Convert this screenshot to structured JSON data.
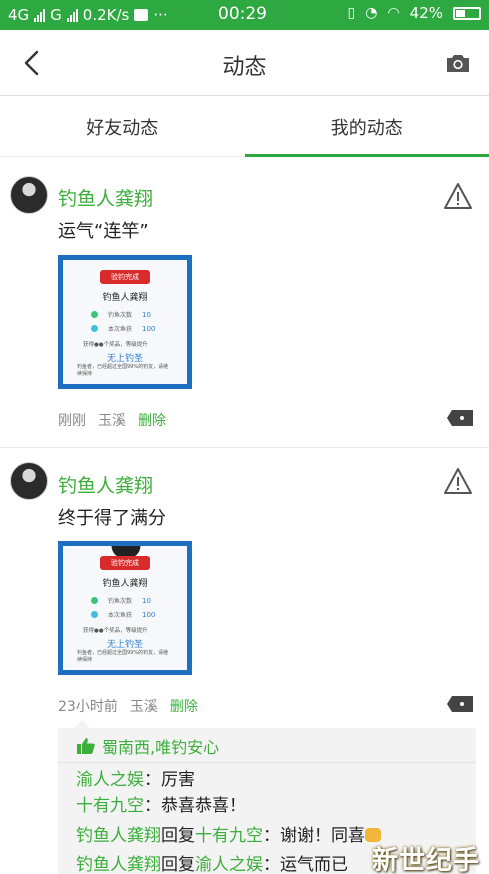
{
  "status_bar": {
    "network_type": "4G",
    "network_type2": "G",
    "speed": "0.2K/s",
    "more": "···",
    "time": "00:29",
    "battery": "42%"
  },
  "nav": {
    "title": "动态"
  },
  "tabs": [
    {
      "label": "好友动态",
      "active": false
    },
    {
      "label": "我的动态",
      "active": true
    }
  ],
  "posts": [
    {
      "username": "钓鱼人龚翔",
      "text": "运气“连竿”",
      "image": {
        "ribbon": "验钓完成",
        "name": "钓鱼人龚翔",
        "row1_label": "钓鱼次数",
        "row1_value": "10",
        "row2_label": "本次鱼获",
        "row2_value": "100",
        "line": "获得●●个奖品，等级提升",
        "blue": "无上钓圣",
        "small": "钓鱼者，已经超过全国99%的钓友，请继续保持"
      },
      "time": "刚刚",
      "location": "玉溪",
      "delete": "删除"
    },
    {
      "username": "钓鱼人龚翔",
      "text": "终于得了满分",
      "image": {
        "ribbon": "验钓完成",
        "name": "钓鱼人龚翔",
        "row1_label": "钓鱼次数",
        "row1_value": "10",
        "row2_label": "本次鱼获",
        "row2_value": "100",
        "line": "获得●●个奖品，等级提升",
        "blue": "无上钓圣",
        "small": "钓鱼者，已经超过全国99%的钓友，请继续保持"
      },
      "time": "23小时前",
      "location": "玉溪",
      "delete": "删除"
    }
  ],
  "comments": {
    "likes": "蜀南西,唯钓安心",
    "items": [
      {
        "user": "渝人之娱",
        "sep": "：",
        "text": "厉害"
      },
      {
        "user": "十有九空",
        "sep": "：",
        "text": "恭喜恭喜！"
      },
      {
        "user": "钓鱼人龚翔",
        "reply": "回复",
        "target": "十有九空",
        "sep": "：",
        "text": "谢谢！同喜"
      },
      {
        "user": "钓鱼人龚翔",
        "reply": "回复",
        "target": "渝人之娱",
        "sep": "：",
        "text": "运气而已"
      }
    ]
  },
  "watermark": "新世纪手游",
  "colors": {
    "accent": "#2ea840",
    "username": "#3bae3b",
    "card_border": "#1e6fc0"
  }
}
